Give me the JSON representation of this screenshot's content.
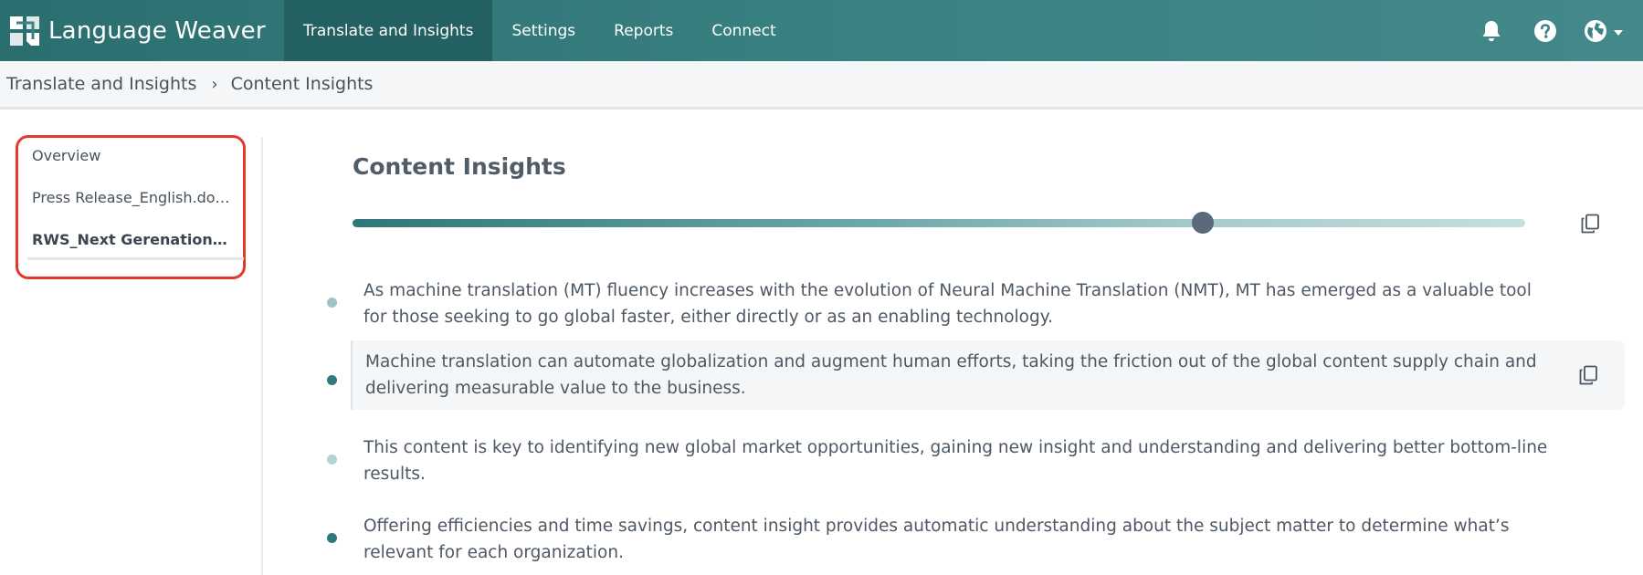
{
  "app": {
    "brand_name": "Language Weaver",
    "logo_icon": "language-weaver-logo-icon"
  },
  "nav": {
    "items": [
      {
        "label": "Translate and Insights",
        "active": true
      },
      {
        "label": "Settings",
        "active": false
      },
      {
        "label": "Reports",
        "active": false
      },
      {
        "label": "Connect",
        "active": false
      }
    ],
    "icons": [
      "bell-icon",
      "help-icon",
      "globe-icon"
    ]
  },
  "breadcrumb": {
    "parent": "Translate and Insights",
    "separator": "›",
    "current": "Content Insights"
  },
  "sidebar": {
    "items": [
      {
        "label": "Overview",
        "active": false
      },
      {
        "label": "Press Release_English.docx",
        "active": false
      },
      {
        "label": "RWS_Next Gerenation M...",
        "active": true
      }
    ],
    "highlight_color": "#e2392c"
  },
  "main": {
    "title": "Content Insights",
    "summary_slider": {
      "value_fraction": 0.725
    },
    "insights": [
      {
        "text": "As machine translation (MT) fluency increases with the evolution of Neural Machine Translation (NMT), MT has emerged as a valuable tool for those seeking to go global faster, either directly or as an enabling technology.",
        "bullet_color": "#9fc4c2",
        "highlighted": false
      },
      {
        "text": "Machine translation can automate globalization and augment human efforts, taking the friction out of the global content supply chain and delivering measurable value to the business.",
        "bullet_color": "#2f7a7b",
        "highlighted": true
      },
      {
        "text": "This content is key to identifying new global market opportunities, gaining new insight and understanding and delivering better bottom-line results.",
        "bullet_color": "#b4d3d2",
        "highlighted": false
      },
      {
        "text": "Offering efficiencies and time savings, content insight provides automatic understanding about the subject matter to determine what’s relevant for each organization.",
        "bullet_color": "#2f7a7b",
        "highlighted": false
      }
    ]
  },
  "colors": {
    "header_bg": "#3a8283",
    "nav_active_bg": "#236062",
    "accent": "#2f7779"
  }
}
